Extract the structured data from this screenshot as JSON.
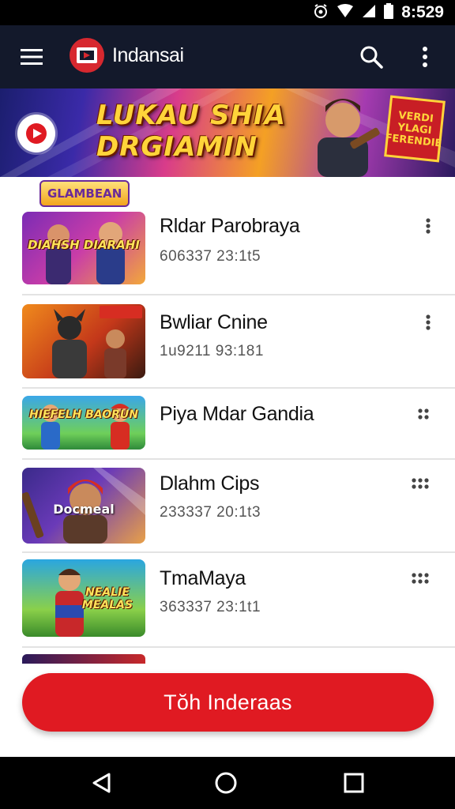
{
  "status_bar": {
    "time": "8:529",
    "icons": [
      "alarm-icon",
      "wifi-icon",
      "signal-icon",
      "battery-icon"
    ]
  },
  "app_bar": {
    "title": "Indansai",
    "icons": [
      "menu-icon",
      "app-logo-icon",
      "search-icon",
      "more-vert-icon"
    ]
  },
  "banner": {
    "title_line1": "LUKAU SHIA",
    "title_line2": "DRGIAMIN",
    "badge": "VERDI YLAGI FERENDIE",
    "icon": "play-icon"
  },
  "section": {
    "label": "GLAMBEAN"
  },
  "items": [
    {
      "title": "Rldar Parobraya",
      "time": "606337 23:1t5",
      "thumb_caption": "DIAHSH DIARAHI",
      "menu_icon": "more-vert-icon"
    },
    {
      "title": "Bwliar Cnine",
      "time": "1u9211 93:181",
      "thumb_caption": "",
      "menu_icon": "more-vert-icon"
    },
    {
      "title": "Piya Mdar Gandia",
      "time": "",
      "thumb_caption": "HIEFELH BAORUN",
      "menu_icon": "grid-dots-icon"
    },
    {
      "title": "Dlahm Cips",
      "time": "233337 20:1t3",
      "thumb_caption": "Docmeal",
      "menu_icon": "grid-dots-icon"
    },
    {
      "title": "TmaMaya",
      "time": "363337 23:1t1",
      "thumb_caption": "NEALIE MEALAS",
      "menu_icon": "grid-dots-icon"
    }
  ],
  "cta": {
    "label": "Tŏh Inderaas"
  },
  "nav_bar": {
    "icons": [
      "back-icon",
      "home-icon",
      "recents-icon"
    ]
  },
  "colors": {
    "accent": "#e01a22",
    "app_bar": "#13192b",
    "status_bar": "#000000"
  }
}
